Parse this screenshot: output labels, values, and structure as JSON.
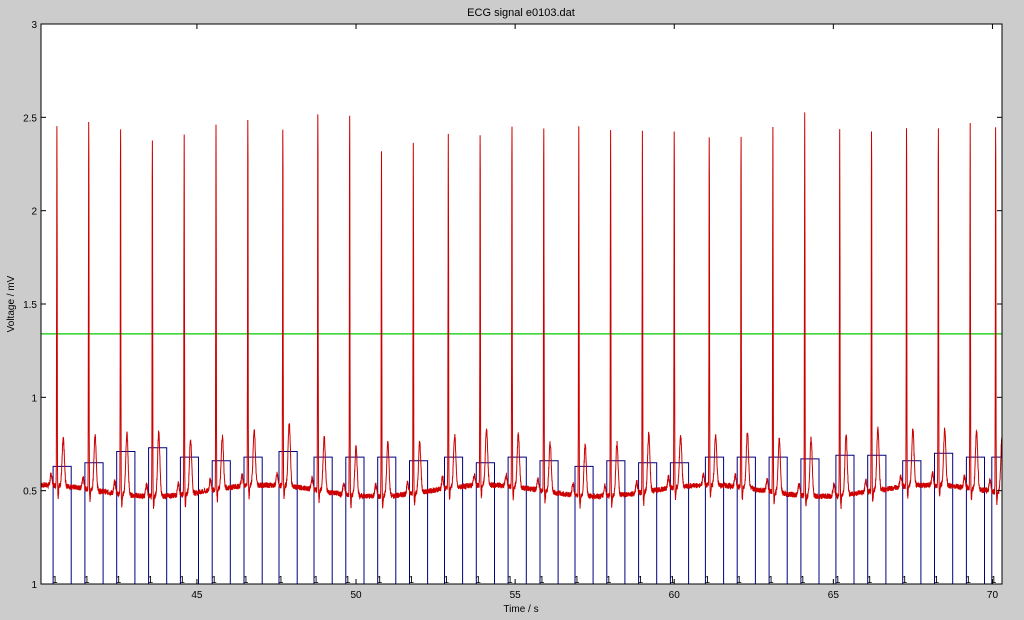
{
  "chart_data": {
    "type": "line",
    "title": "ECG signal e0103.dat",
    "xlabel": "Time / s",
    "ylabel": "Voltage / mV",
    "xlim": [
      40.1,
      70.3
    ],
    "ylim": [
      0,
      3
    ],
    "xticks": [
      45,
      50,
      55,
      60,
      65,
      70
    ],
    "yticks": [
      0,
      0.5,
      1,
      1.5,
      2,
      2.5,
      3
    ],
    "ytick_labels": [
      "1",
      "0.5",
      "1",
      "1.5",
      "2",
      "2.5",
      "3"
    ],
    "grid": false,
    "threshold": 1.34,
    "r_peak_times": [
      40.6,
      41.6,
      42.6,
      43.6,
      44.6,
      45.6,
      46.6,
      47.7,
      48.8,
      49.8,
      50.8,
      51.8,
      52.9,
      53.9,
      54.9,
      55.9,
      57.0,
      58.0,
      59.0,
      60.0,
      61.1,
      62.1,
      63.1,
      64.1,
      65.2,
      66.2,
      67.3,
      68.3,
      69.3,
      70.1
    ],
    "r_peak_values": [
      2.43,
      2.47,
      2.46,
      2.4,
      2.44,
      2.46,
      2.46,
      2.41,
      2.52,
      2.52,
      2.36,
      2.37,
      2.4,
      2.38,
      2.43,
      2.44,
      2.49,
      2.47,
      2.45,
      2.41,
      2.36,
      2.39,
      2.45,
      2.55,
      2.45,
      2.44,
      2.42,
      2.41,
      2.46,
      2.46
    ],
    "t_wave_values": [
      0.75,
      0.79,
      0.83,
      0.84,
      0.79,
      0.78,
      0.8,
      0.84,
      0.79,
      0.76,
      0.79,
      0.77,
      0.78,
      0.8,
      0.78,
      0.76,
      0.77,
      0.78,
      0.81,
      0.78,
      0.76,
      0.8,
      0.79,
      0.81,
      0.82,
      0.83,
      0.8,
      0.8,
      0.81,
      0.81
    ],
    "baseline_level": 0.5,
    "window_heights": [
      0.63,
      0.65,
      0.71,
      0.73,
      0.68,
      0.66,
      0.68,
      0.71,
      0.68,
      0.68,
      0.68,
      0.66,
      0.68,
      0.65,
      0.68,
      0.66,
      0.63,
      0.66,
      0.65,
      0.65,
      0.68,
      0.68,
      0.68,
      0.67,
      0.69,
      0.69,
      0.66,
      0.7,
      0.68,
      0.68
    ],
    "qrs_marks_label": "1",
    "colors": {
      "ecg": "#cc0000",
      "threshold": "#00cc00",
      "windows": "#000080",
      "axes": "#000000",
      "plot_background": "#ffffff",
      "figure_background": "#cccccc"
    }
  }
}
